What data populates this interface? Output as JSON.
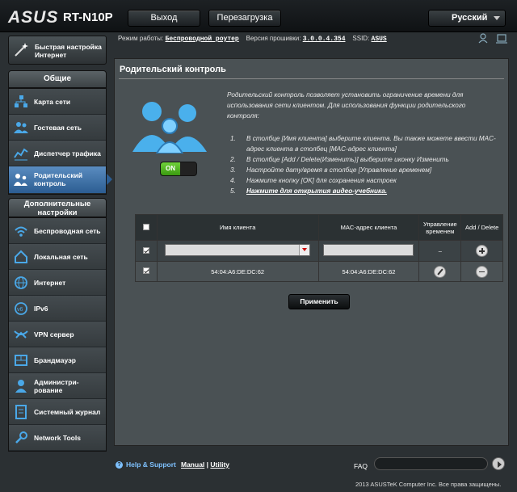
{
  "brand": {
    "logo": "ASUS",
    "model": "RT-N10P"
  },
  "top": {
    "logout": "Выход",
    "reboot": "Перезагрузка",
    "language": "Русский"
  },
  "sidebar": {
    "quick_setup": "Быстрая настройка Интернет",
    "general_header": "Общие",
    "general": [
      {
        "label": "Карта сети",
        "icon": "network-map-icon"
      },
      {
        "label": "Гостевая сеть",
        "icon": "guest-network-icon"
      },
      {
        "label": "Диспетчер трафика",
        "icon": "traffic-manager-icon"
      },
      {
        "label": "Родительский контроль",
        "icon": "parental-control-icon"
      }
    ],
    "advanced_header": "Дополнительные настройки",
    "advanced": [
      {
        "label": "Беспроводная сеть",
        "icon": "wireless-icon"
      },
      {
        "label": "Локальная сеть",
        "icon": "lan-icon"
      },
      {
        "label": "Интернет",
        "icon": "internet-icon"
      },
      {
        "label": "IPv6",
        "icon": "ipv6-icon"
      },
      {
        "label": "VPN сервер",
        "icon": "vpn-icon"
      },
      {
        "label": "Брандмауэр",
        "icon": "firewall-icon"
      },
      {
        "label": "Администри-рование",
        "icon": "administration-icon"
      },
      {
        "label": "Системный журнал",
        "icon": "system-log-icon"
      },
      {
        "label": "Network Tools",
        "icon": "network-tools-icon"
      }
    ]
  },
  "info": {
    "mode_label": "Режим работы:",
    "mode_value": "Беспроводной роутер",
    "fw_label": "Версия прошивки:",
    "fw_value": "3.0.0.4.354",
    "ssid_label": "SSID:",
    "ssid_value": "ASUS"
  },
  "main": {
    "title": "Родительский контроль",
    "description": "Родительский контроль позволяет установить ограничение времени для использования сети клиентом. Для использования функции родительского контроля:",
    "toggle": "ON",
    "steps": [
      "В столбце [Имя клиента] выберите клиента. Вы также можете ввести MAC-адрес клиента в столбец [MAC-адрес клиента]",
      "В столбце [Add / Delete(Изменить)] выберите иконку Изменить",
      "Настройте дату/время в столбце [Управление временем]",
      "Нажмите кнопку [OK] для сохранения настроек",
      "Нажмите для открытия видео-учебника."
    ],
    "step_numbers": [
      "1.",
      "2.",
      "3.",
      "4.",
      "5."
    ],
    "table": {
      "headers": [
        "Имя клиента",
        "MAC-адрес клиента",
        "Управление временем",
        "Add / Delete"
      ],
      "row1": {
        "time": "–"
      },
      "row2": {
        "name": "54:04:A6:DE:DC:62",
        "mac": "54:04:A6:DE:DC:62"
      }
    },
    "apply": "Применить"
  },
  "footer": {
    "help": "Help & Support",
    "manual": "Manual",
    "sep": "|",
    "utility": "Utility",
    "faq": "FAQ",
    "copyright": "2013 ASUSTeK Computer Inc. Все права защищены."
  }
}
